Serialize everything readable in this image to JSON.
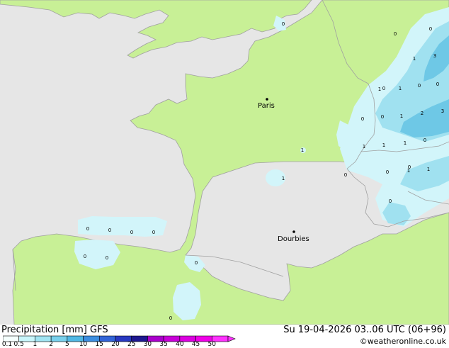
{
  "map": {
    "cities": [
      {
        "name": "Paris"
      },
      {
        "name": "Dourbies"
      }
    ],
    "values": [
      "0",
      "0",
      "1",
      "1",
      "1",
      "1",
      "3",
      "1",
      "0",
      "0",
      "0",
      "1",
      "2",
      "3",
      "1",
      "1",
      "1",
      "0",
      "0",
      "0",
      "1",
      "1",
      "0",
      "0",
      "0",
      "0",
      "0",
      "0",
      "0",
      "0",
      "0",
      "0",
      "0",
      "0",
      "0"
    ]
  },
  "footer": {
    "title": "Precipitation [mm] GFS",
    "datetime": "Su 19-04-2026 03..06 UTC (06+96)",
    "credit": "©weatheronline.co.uk"
  },
  "legend": {
    "ticks": [
      "0.1",
      "0.5",
      "1",
      "2",
      "5",
      "10",
      "15",
      "20",
      "25",
      "30",
      "35",
      "40",
      "45",
      "50"
    ],
    "colors": [
      "#f5fffd",
      "#c8f5fa",
      "#a0e4f2",
      "#78d0ec",
      "#50b8e4",
      "#3c8ee0",
      "#3264d8",
      "#2838c0",
      "#1e1890",
      "#aa00cc",
      "#c800d8",
      "#dc00e0",
      "#f000e8",
      "#ff32ff"
    ]
  },
  "colors": {
    "land": "#c8f096",
    "sea": "#e6e6e6",
    "border": "#a0a0a0",
    "light_precip": "#d2f5fa",
    "medium_precip": "#a0e1f0",
    "heavy_precip": "#6ec8e6"
  }
}
